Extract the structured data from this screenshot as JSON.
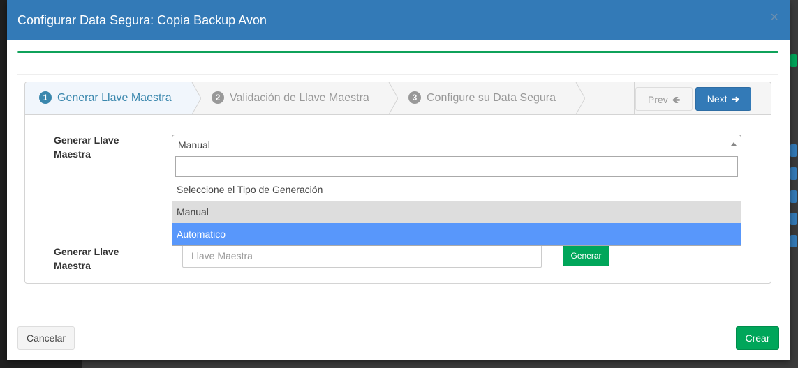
{
  "modal": {
    "title": "Configurar Data Segura: Copia Backup Avon",
    "close_label": "×"
  },
  "wizard": {
    "steps": [
      {
        "number": "1",
        "label": "Generar Llave Maestra",
        "active": true
      },
      {
        "number": "2",
        "label": "Validación de Llave Maestra",
        "active": false
      },
      {
        "number": "3",
        "label": "Configure su Data Segura",
        "active": false
      }
    ],
    "prev_label": "Prev",
    "next_label": "Next",
    "prev_icon": "arrow-left-icon",
    "next_icon": "arrow-right-icon"
  },
  "form": {
    "generation_type_label": "Generar Llave Maestra",
    "generation_type_selected": "Manual",
    "dropdown_search_value": "",
    "dropdown_options": [
      {
        "label": "Seleccione el Tipo de Generación",
        "state": "normal"
      },
      {
        "label": "Manual",
        "state": "selected"
      },
      {
        "label": "Automatico",
        "state": "highlighted"
      }
    ],
    "master_key_label": "Generar Llave Maestra",
    "master_key_placeholder": "Llave Maestra",
    "generate_button_label": "Generar"
  },
  "footer": {
    "cancel_label": "Cancelar",
    "create_label": "Crear"
  },
  "colors": {
    "header": "#337ab7",
    "success": "#00a65a",
    "active_step": "#3a87ad",
    "highlight_option": "#5897fb"
  }
}
